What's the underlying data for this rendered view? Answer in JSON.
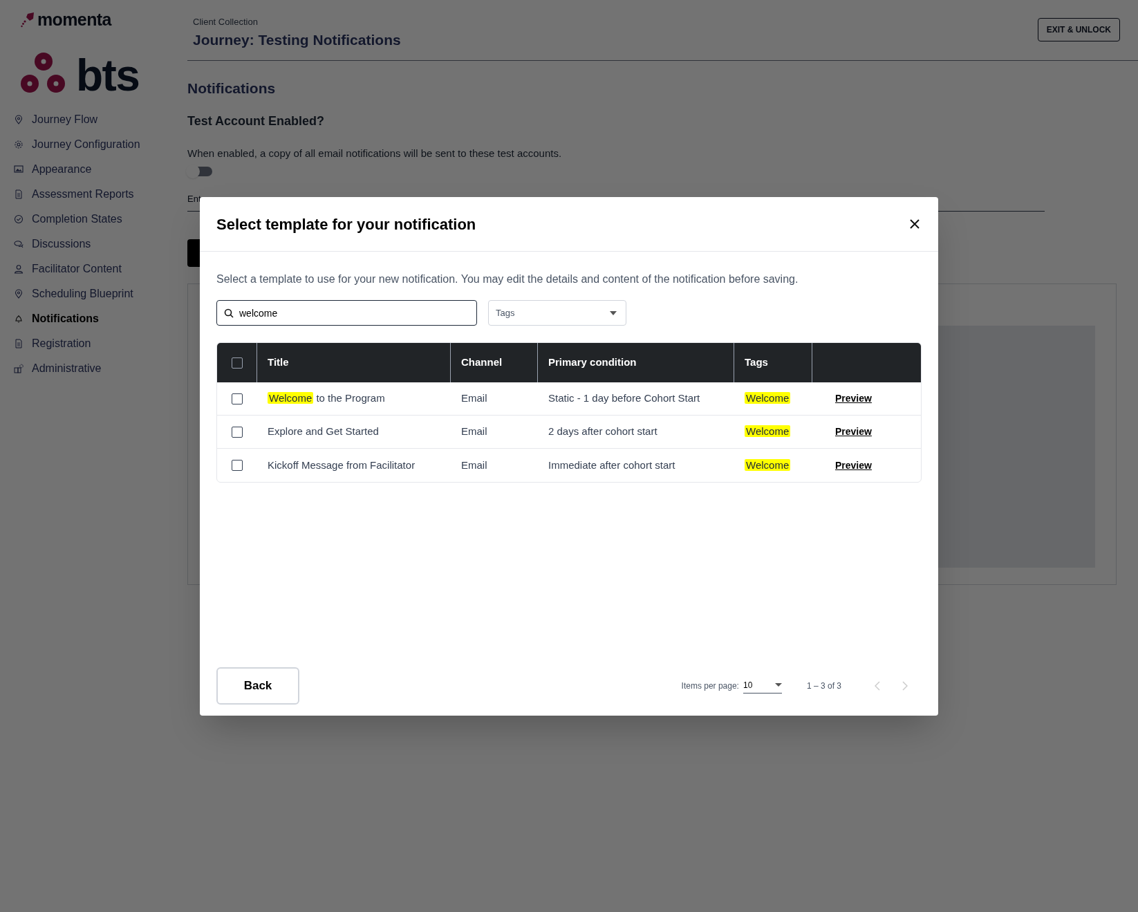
{
  "logos": {
    "brand": "momenta",
    "client": "bts"
  },
  "sidebar": {
    "items": [
      {
        "label": "Journey Flow",
        "selected": false
      },
      {
        "label": "Journey Configuration",
        "selected": false
      },
      {
        "label": "Appearance",
        "selected": false
      },
      {
        "label": "Assessment Reports",
        "selected": false
      },
      {
        "label": "Completion States",
        "selected": false
      },
      {
        "label": "Discussions",
        "selected": false
      },
      {
        "label": "Facilitator Content",
        "selected": false
      },
      {
        "label": "Scheduling Blueprint",
        "selected": false
      },
      {
        "label": "Notifications",
        "selected": true
      },
      {
        "label": "Registration",
        "selected": false
      },
      {
        "label": "Administrative",
        "selected": false
      }
    ]
  },
  "header": {
    "breadcrumb": "Client Collection",
    "title": "Journey: Testing Notifications",
    "exit_button": "EXIT & UNLOCK"
  },
  "page": {
    "heading": "Notifications",
    "subheading": "Test Account Enabled?",
    "description": "When enabled, a copy of all email notifications will be sent to these test accounts.",
    "test_toggle_on": false,
    "email_label": "Ent"
  },
  "modal": {
    "title": "Select template for your notification",
    "description": "Select a template to use for your new notification. You may edit the details and content of the notification before saving.",
    "search": {
      "value": "welcome"
    },
    "tags_filter": {
      "placeholder": "Tags"
    },
    "table": {
      "select_all_checked": false,
      "columns": [
        "Title",
        "Channel",
        "Primary condition",
        "Tags"
      ],
      "rows": [
        {
          "checked": false,
          "title_parts": [
            {
              "text": "Welcome",
              "highlighted": true
            },
            {
              "text": " to the Program",
              "highlighted": false
            }
          ],
          "channel": "Email",
          "condition": "Static - 1 day before Cohort Start",
          "tag": {
            "text": "Welcome",
            "highlighted": true
          },
          "action": "Preview"
        },
        {
          "checked": false,
          "title_parts": [
            {
              "text": "Explore and Get Started",
              "highlighted": false
            }
          ],
          "channel": "Email",
          "condition": "2 days after cohort start",
          "tag": {
            "text": "Welcome",
            "highlighted": true
          },
          "action": "Preview"
        },
        {
          "checked": false,
          "title_parts": [
            {
              "text": "Kickoff Message from Facilitator",
              "highlighted": false
            }
          ],
          "channel": "Email",
          "condition": "Immediate after cohort start",
          "tag": {
            "text": "Welcome",
            "highlighted": true
          },
          "action": "Preview"
        }
      ]
    },
    "back_button": "Back",
    "pagination": {
      "items_per_page_label": "Items per page:",
      "items_per_page": "10",
      "range": "1 – 3 of 3",
      "prev_disabled": true,
      "next_disabled": true
    }
  }
}
